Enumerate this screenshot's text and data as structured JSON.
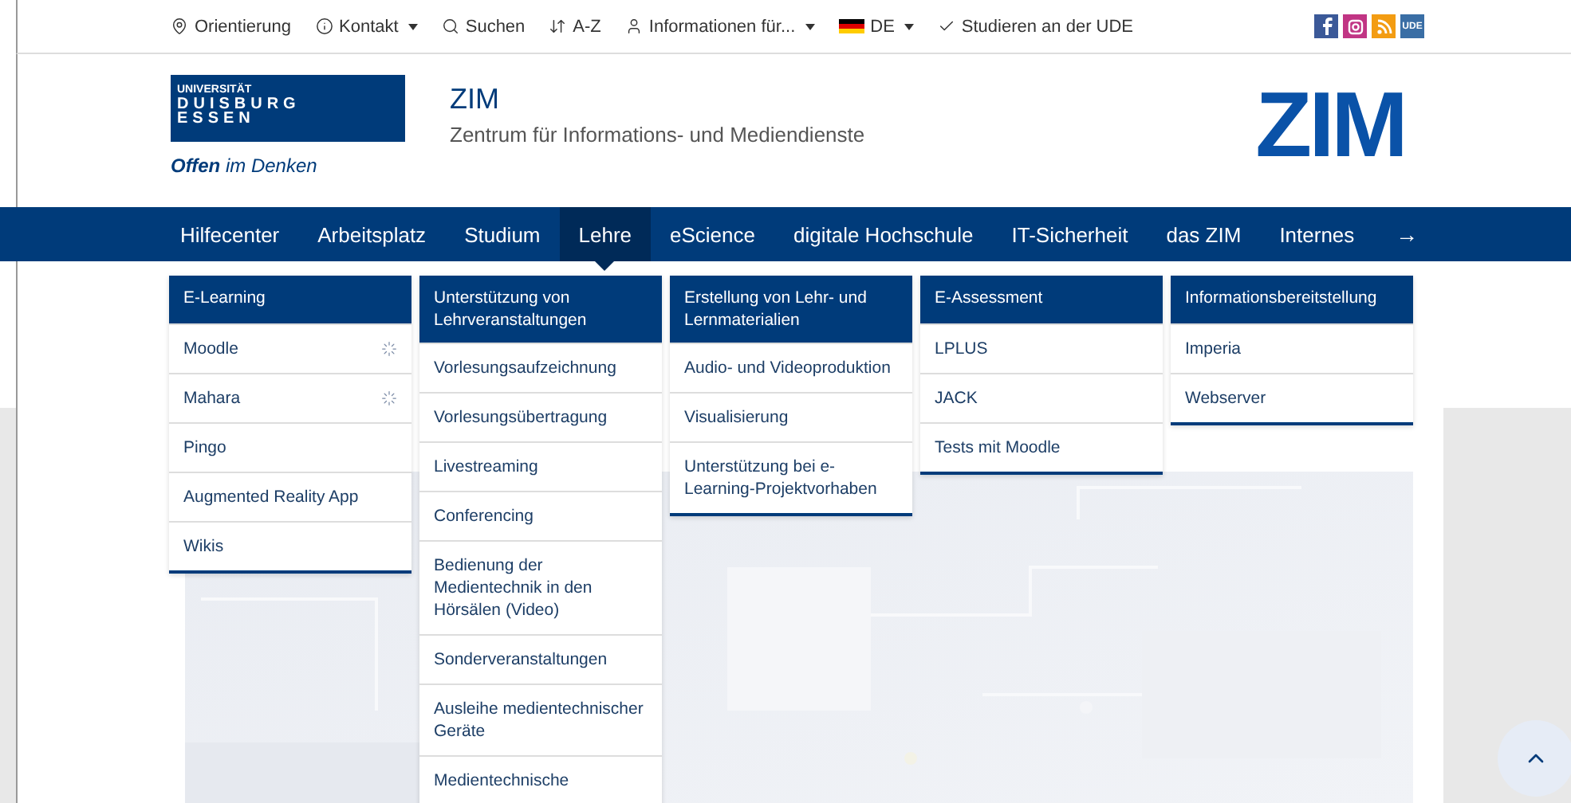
{
  "top_bar": {
    "items": [
      {
        "kind": "pin",
        "label": "Orientierung",
        "dropdown": false
      },
      {
        "kind": "info",
        "label": "Kontakt",
        "dropdown": true
      },
      {
        "kind": "search",
        "label": "Suchen",
        "dropdown": false
      },
      {
        "kind": "sort",
        "label": "A-Z",
        "dropdown": false
      },
      {
        "kind": "user",
        "label": "Informationen für...",
        "dropdown": true
      },
      {
        "kind": "flag",
        "label": "DE",
        "dropdown": true
      },
      {
        "kind": "check",
        "label": "Studieren an der UDE",
        "dropdown": false
      }
    ],
    "social": [
      {
        "kind": "facebook",
        "color": "#3b5998"
      },
      {
        "kind": "instagram",
        "color": "#c13584"
      },
      {
        "kind": "rss",
        "color": "#f39c12"
      },
      {
        "kind": "ude",
        "color": "#3a6ea5",
        "label": "UDE"
      }
    ]
  },
  "header": {
    "university_logo": {
      "lines": [
        "UNIVERSITÄT",
        "DUISBURG",
        "ESSEN"
      ],
      "slogan": "**Offen** im Denken"
    },
    "title": "ZIM",
    "subtitle": "Zentrum für Informations- und Mediendienste",
    "logo": "ZIM"
  },
  "nav": {
    "items": [
      {
        "label": "Hilfecenter",
        "selected": false
      },
      {
        "label": "Arbeitsplatz",
        "selected": false
      },
      {
        "label": "Studium",
        "selected": false
      },
      {
        "label": "Lehre",
        "selected": true
      },
      {
        "label": "eScience",
        "selected": false
      },
      {
        "label": "digitale Hochschule",
        "selected": false
      },
      {
        "label": "IT-Sicherheit",
        "selected": false
      },
      {
        "label": "das ZIM",
        "selected": false
      },
      {
        "label": "Internes",
        "selected": false
      }
    ],
    "next": "→"
  },
  "mega_menu": {
    "columns": [
      {
        "heading": "E-Learning",
        "items": [
          {
            "label": "Moodle",
            "spinner": true
          },
          {
            "label": "Mahara",
            "spinner": true
          },
          {
            "label": "Pingo",
            "spinner": false
          },
          {
            "label": "Augmented Reality App",
            "spinner": false
          },
          {
            "label": "Wikis",
            "spinner": false
          }
        ]
      },
      {
        "heading": "Unterstützung von Lehrveranstaltungen",
        "items": [
          {
            "label": "Vorlesungsaufzeichnung",
            "spinner": false
          },
          {
            "label": "Vorlesungsübertragung",
            "spinner": false
          },
          {
            "label": "Livestreaming",
            "spinner": false
          },
          {
            "label": "Conferencing",
            "spinner": false
          },
          {
            "label": "Bedienung der Medientechnik in den Hörsälen (Video)",
            "spinner": false
          },
          {
            "label": "Sonderveranstaltungen",
            "spinner": false
          },
          {
            "label": "Ausleihe medientechnischer Geräte",
            "spinner": false
          },
          {
            "label": "Medientechnische",
            "spinner": false
          }
        ]
      },
      {
        "heading": "Erstellung von Lehr- und Lernmaterialien",
        "items": [
          {
            "label": "Audio- und Videoproduktion",
            "spinner": false
          },
          {
            "label": "Visualisierung",
            "spinner": false
          },
          {
            "label": "Unterstützung bei e-Learning-Projektvorhaben",
            "spinner": false
          }
        ]
      },
      {
        "heading": "E-Assessment",
        "items": [
          {
            "label": "LPLUS",
            "spinner": false
          },
          {
            "label": "JACK",
            "spinner": false
          },
          {
            "label": "Tests mit Moodle",
            "spinner": false
          }
        ]
      },
      {
        "heading": "Informationsbereitstellung",
        "items": [
          {
            "label": "Imperia",
            "spinner": false
          },
          {
            "label": "Webserver",
            "spinner": false
          }
        ]
      }
    ]
  },
  "back_to_top": {
    "kind": "chevron"
  }
}
